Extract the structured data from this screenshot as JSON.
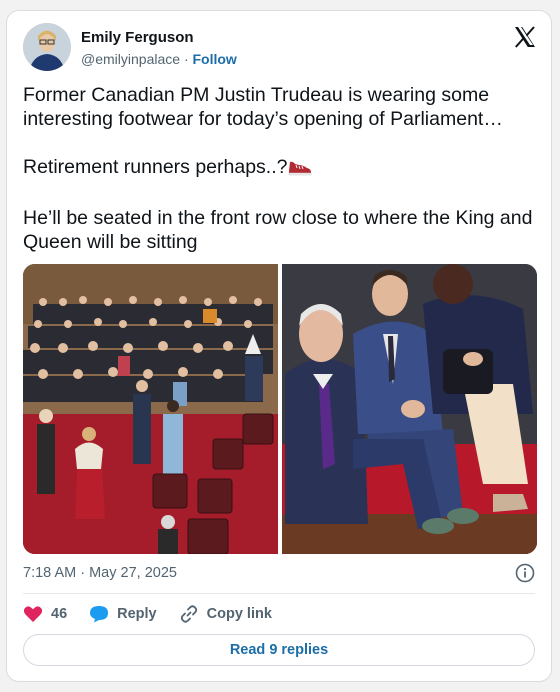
{
  "author": {
    "name": "Emily Ferguson",
    "handle": "@emilyinpalace",
    "separator": "·",
    "follow_label": "Follow"
  },
  "brand_icon": "x-logo",
  "tweet": {
    "paragraph1": "Former Canadian PM Justin Trudeau is wearing some interesting footwear for today’s opening of Parliament…",
    "paragraph2": "Retirement runners perhaps..?",
    "paragraph2_emoji": "sneaker-emoji",
    "paragraph3": "He’ll be seated in the front row close to where the King and Queen will be sitting"
  },
  "media": {
    "images": [
      "senate-chamber-crowd-photo",
      "seated-men-closeup-photo"
    ]
  },
  "timestamp": "7:18 AM · May 27, 2025",
  "actions": {
    "likes_count": "46",
    "reply_label": "Reply",
    "copy_link_label": "Copy link"
  },
  "read_replies_label": "Read 9 replies",
  "colors": {
    "like": "#e0245e",
    "reply": "#1d9bf0",
    "link": "#1d6ea8",
    "carpet": "#b8192a"
  }
}
